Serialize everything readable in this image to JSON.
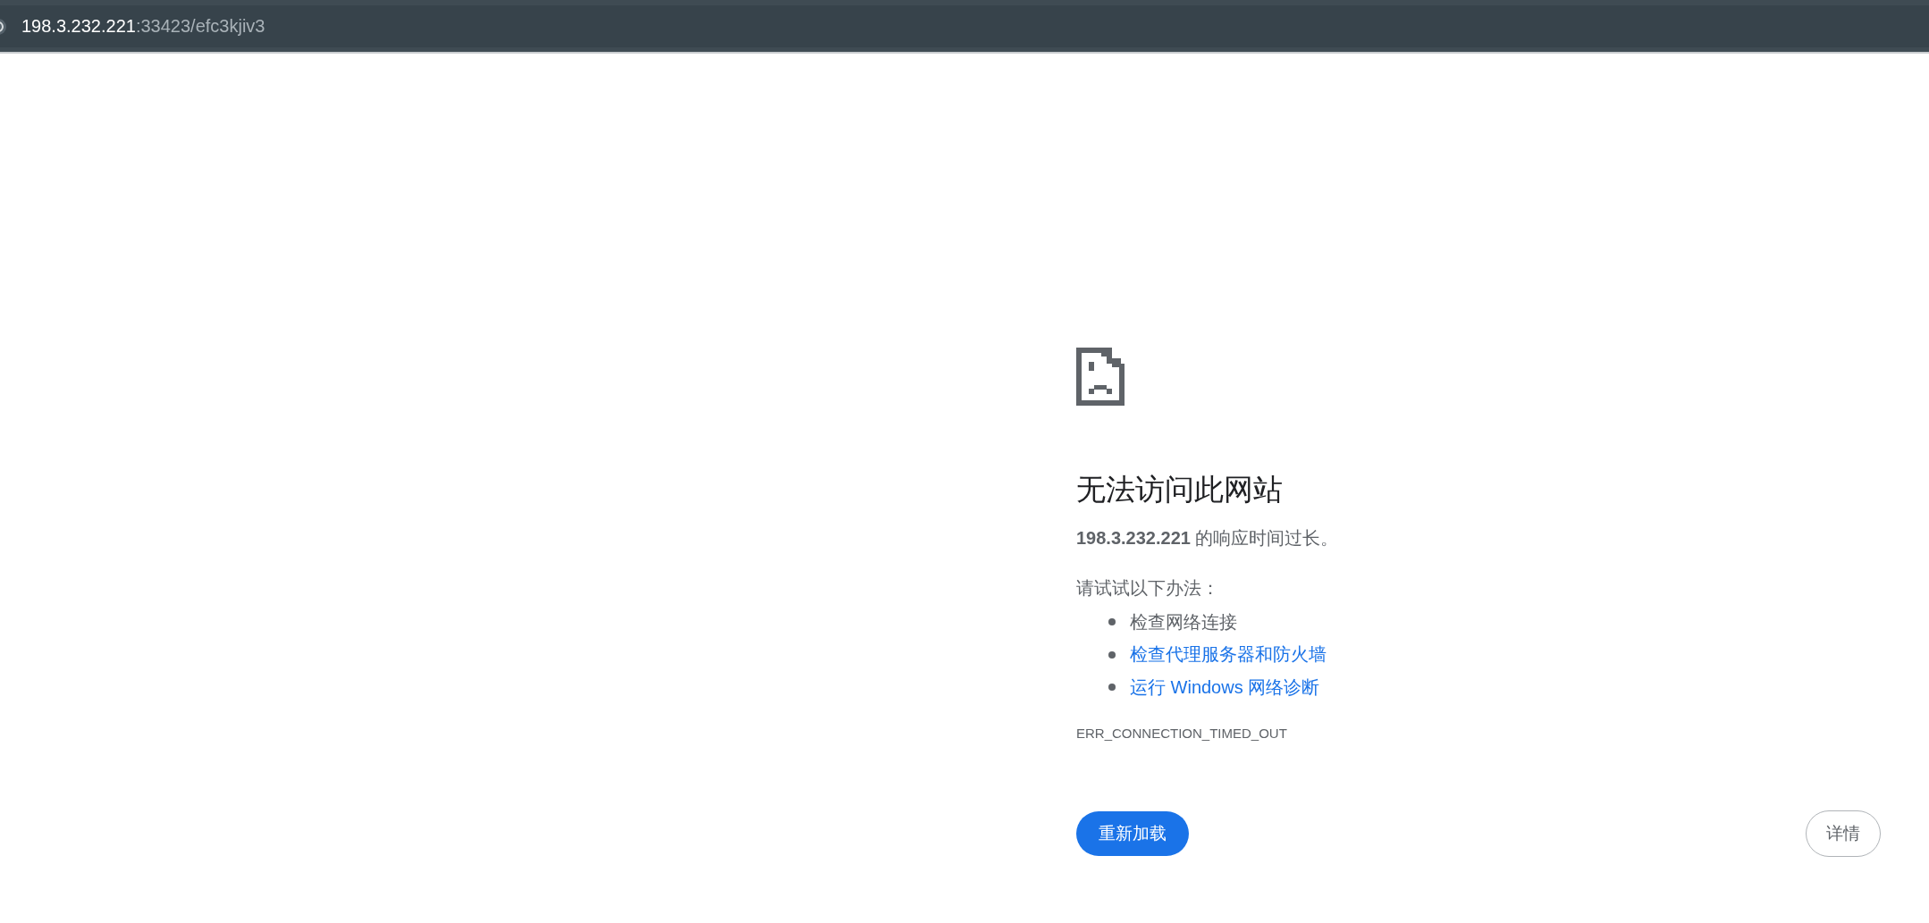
{
  "address_bar": {
    "host": "198.3.232.221",
    "path": ":33423/efc3kjiv3"
  },
  "error": {
    "title": "无法访问此网站",
    "message": "**198.3.232.221** 的响应时间过长。",
    "suggestions_intro": "请试试以下办法：",
    "suggestions": [
      {
        "text": "检查网络连接",
        "kind": "plain"
      },
      {
        "text": "检查代理服务器和防火墙",
        "kind": "link"
      },
      {
        "text": "运行 Windows 网络诊断",
        "kind": "link"
      }
    ],
    "code": "ERR_CONNECTION_TIMED_OUT"
  },
  "buttons": {
    "reload": "重新加载",
    "details": "详情"
  }
}
